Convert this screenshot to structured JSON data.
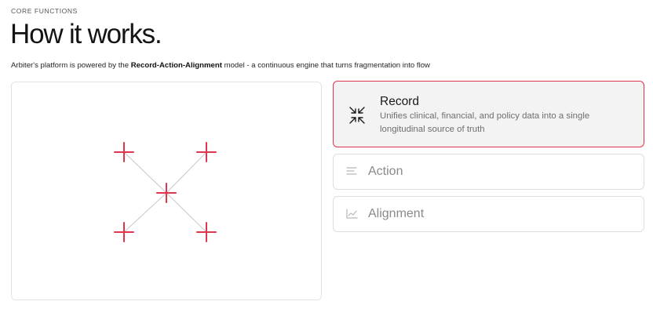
{
  "header": {
    "eyebrow": "CORE FUNCTIONS",
    "title": "How it works.",
    "subtitle_prefix": "Arbiter's platform is powered by the ",
    "subtitle_emphasis": "Record-Action-Alignment",
    "subtitle_suffix": " model - a continuous engine that turns fragmentation into flow"
  },
  "colors": {
    "accent": "#e0354d",
    "muted_icon": "#b8b8b8",
    "panel_border": "#e3e3e3"
  },
  "visual": {
    "marker_icon": "plus-marker-icon",
    "connector_icon": "connector-line"
  },
  "cards": [
    {
      "title": "Record",
      "icon": "collapse-arrows-icon",
      "description": "Unifies clinical, financial, and policy data into a single longitudinal source of truth",
      "active": true
    },
    {
      "title": "Action",
      "icon": "lines-icon",
      "active": false
    },
    {
      "title": "Alignment",
      "icon": "chart-line-icon",
      "active": false
    }
  ]
}
